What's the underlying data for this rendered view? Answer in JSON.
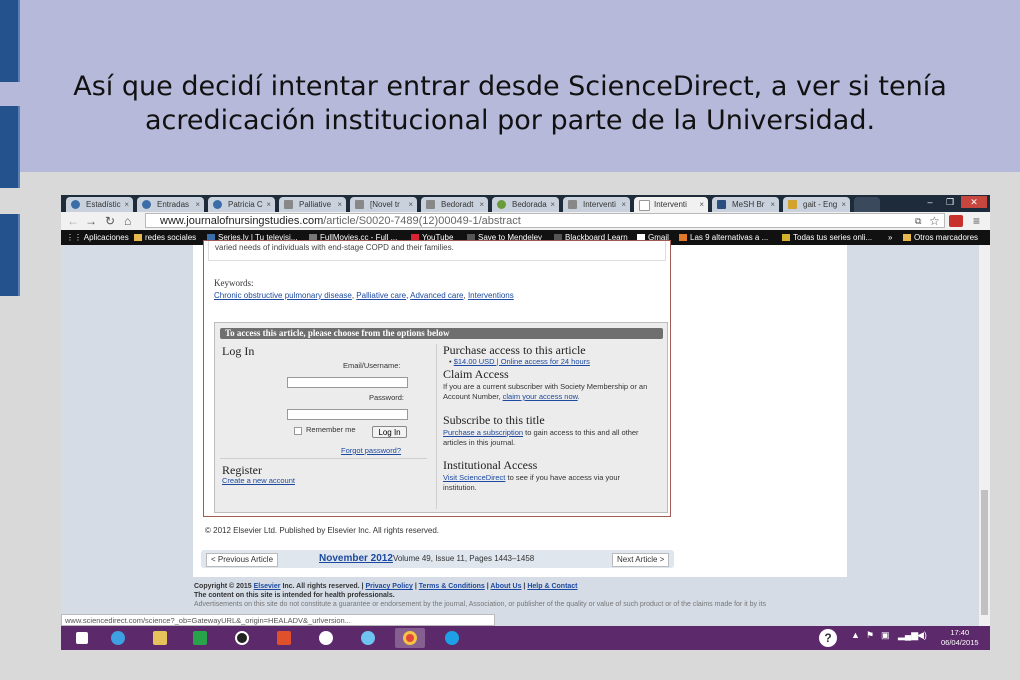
{
  "slide": {
    "title_line1": "Así que decidí intentar entrar desde ScienceDirect, a ver si tenía",
    "title_line2": "acredicación institucional por parte de la Universidad."
  },
  "browser": {
    "tabs": [
      {
        "label": "Estadístic"
      },
      {
        "label": "Entradas"
      },
      {
        "label": "Patricia C"
      },
      {
        "label": "Palliative"
      },
      {
        "label": "[Novel tr"
      },
      {
        "label": "Bedoradt"
      },
      {
        "label": "Bedorada"
      },
      {
        "label": "Interventi"
      },
      {
        "label": "Interventi"
      },
      {
        "label": "MeSH Br"
      },
      {
        "label": "gait - Eng"
      }
    ],
    "url_domain": "www.journalofnursingstudies.com",
    "url_path": "/article/S0020-7489(12)00049-1/abstract",
    "bookmarks": [
      "Aplicaciones",
      "redes sociales",
      "Series.ly | Tu televisi...",
      "FullMovies.cc - Full ...",
      "YouTube",
      "Save to Mendeley",
      "Blackboard Learn",
      "Gmail",
      "Las 9 alternativas a ...",
      "Todas tus series onli...",
      "»",
      "Otros marcadores"
    ],
    "status_url": "www.sciencedirect.com/science?_ob=GatewayURL&_origin=HEALADV&_urlversion..."
  },
  "article": {
    "abstract_tail": "varied needs of individuals with end-stage COPD and their families.",
    "keywords_title": "Keywords:",
    "keywords": [
      "Chronic obstructive pulmonary disease",
      "Palliative care",
      "Advanced care",
      "Interventions"
    ],
    "access_header": "To access this article, please choose from the options below",
    "login": {
      "title": "Log In",
      "email_label": "Email/Username:",
      "password_label": "Password:",
      "remember": "Remember me",
      "button": "Log In",
      "forgot": "Forgot password?"
    },
    "register": {
      "title": "Register",
      "link": "Create a new account"
    },
    "purchase": {
      "title": "Purchase access to this article",
      "option": "$14.00 USD | Online access for 24 hours"
    },
    "claim": {
      "title": "Claim Access",
      "text": "If you are a current subscriber with Society Membership or an Account Number,",
      "link": "claim your access now",
      "text_end": "."
    },
    "subscribe": {
      "title": "Subscribe to this title",
      "link": "Purchase a subscription",
      "text": "to gain access to this and all other articles in this journal."
    },
    "institutional": {
      "title": "Institutional Access",
      "link": "Visit ScienceDirect",
      "text": "to see if you have access via your institution."
    },
    "copyright": "© 2012 Elsevier Ltd. Published by Elsevier Inc. All rights reserved.",
    "pager": {
      "prev": "< Previous Article",
      "issue_link": "November 2012",
      "issue_text": "Volume 49, Issue 11, Pages 1443–1458",
      "next": "Next Article >"
    }
  },
  "footer": {
    "line1_a": "Copyright © 2015",
    "line1_link": "Elsevier",
    "line1_b": "Inc. All rights reserved. |",
    "links": [
      "Privacy Policy",
      "Terms & Conditions",
      "About Us",
      "Help & Contact"
    ],
    "line2": "The content on this site is intended for health professionals.",
    "line3": "Advertisements on this site do not constitute a guarantee or endorsement by the journal, Association, or publisher of the quality or value of such product or of the claims made for it by its"
  },
  "taskbar": {
    "time": "17:40",
    "date": "06/04/2015"
  },
  "colors": {
    "slide_bg": "#b6b9d9",
    "slide_lower_bg": "#d9d9d9",
    "left_bar": "#24528c",
    "taskbar": "#5c2a6a",
    "link": "#1d4aa0",
    "article_border": "#a25a55"
  }
}
